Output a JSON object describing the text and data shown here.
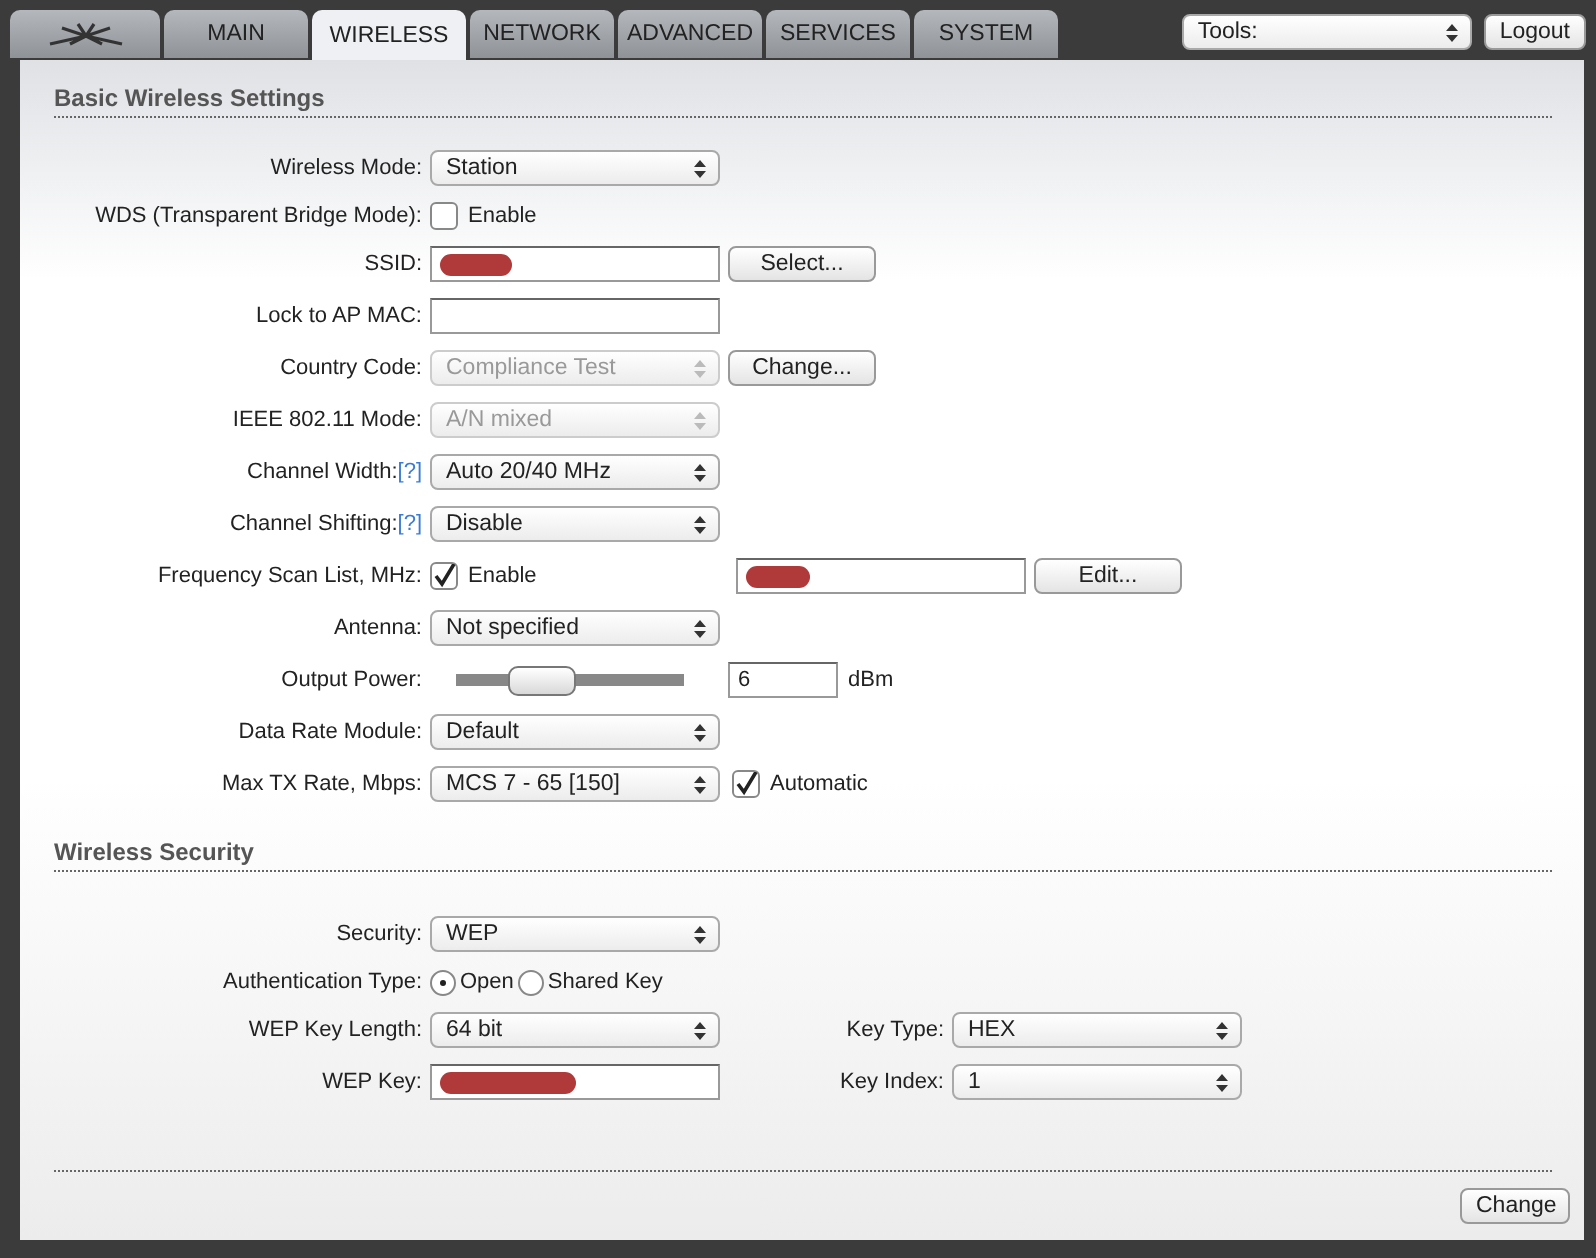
{
  "tabs": [
    {
      "kind": "logo",
      "selected": false
    },
    {
      "label": "MAIN",
      "selected": false
    },
    {
      "label": "WIRELESS",
      "selected": true
    },
    {
      "label": "NETWORK",
      "selected": false
    },
    {
      "label": "ADVANCED",
      "selected": false
    },
    {
      "label": "SERVICES",
      "selected": false
    },
    {
      "label": "SYSTEM",
      "selected": false
    }
  ],
  "tools": {
    "value": "Tools:"
  },
  "logout": "Logout",
  "sections": [
    {
      "title": "Basic Wireless Settings",
      "rows": [
        {
          "label": "Wireless Mode:",
          "kind": "select",
          "value": "Station"
        },
        {
          "label": "WDS (Transparent Bridge Mode):",
          "kind": "checkbox",
          "checked": false,
          "text": "Enable"
        },
        {
          "label": "SSID:",
          "kind": "input",
          "redacted": true,
          "button": "Select..."
        },
        {
          "label": "Lock to AP MAC:",
          "kind": "input"
        },
        {
          "label": "Country Code:",
          "kind": "select",
          "value": "Compliance Test",
          "disabled": true,
          "button": "Change..."
        },
        {
          "label": "IEEE 802.11 Mode:",
          "kind": "select",
          "value": "A/N mixed",
          "disabled": true
        },
        {
          "label": "Channel Width:",
          "help": "[?]",
          "kind": "select",
          "value": "Auto 20/40 MHz"
        },
        {
          "label": "Channel Shifting:",
          "help": "[?]",
          "kind": "select",
          "value": "Disable"
        },
        {
          "label": "Frequency Scan List, MHz:",
          "kind": "checkbox",
          "checked": true,
          "text": "Enable",
          "field": {
            "redacted": true
          },
          "button": "Edit..."
        },
        {
          "label": "Antenna:",
          "kind": "select",
          "value": "Not specified"
        },
        {
          "label": "Output Power:",
          "kind": "slider",
          "level": 0.38,
          "value": "6",
          "unit": "dBm"
        },
        {
          "label": "Data Rate Module:",
          "kind": "select",
          "value": "Default"
        },
        {
          "label": "Max TX Rate, Mbps:",
          "kind": "select",
          "value": "MCS 7 - 65 [150]",
          "check": {
            "checked": true,
            "text": "Automatic"
          }
        }
      ]
    },
    {
      "title": "Wireless Security",
      "rows": [
        {
          "label": "Security:",
          "kind": "select",
          "value": "WEP"
        },
        {
          "label": "Authentication Type:",
          "kind": "radio",
          "options": [
            {
              "text": "Open",
              "selected": true
            },
            {
              "text": "Shared Key",
              "selected": false
            }
          ]
        },
        {
          "label": "WEP Key Length:",
          "kind": "select",
          "value": "64 bit",
          "right": {
            "label": "Key Type:",
            "value": "HEX"
          }
        },
        {
          "label": "WEP Key:",
          "kind": "input",
          "redacted": true,
          "right": {
            "label": "Key Index:",
            "value": "1"
          }
        }
      ]
    }
  ],
  "submit": "Change"
}
